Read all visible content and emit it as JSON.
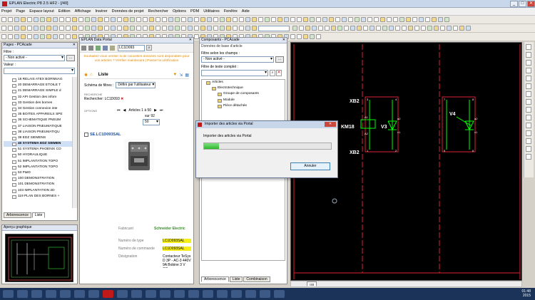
{
  "app": {
    "title": "EPLAN Electric P8 2.5 HF2 - [/40]",
    "min": "_",
    "max": "□",
    "close": "✕"
  },
  "menu": [
    "Projet",
    "Page",
    "Espace layout",
    "Edition",
    "Affichage",
    "Insérer",
    "Données de projet",
    "Rechercher",
    "Options",
    "PDM",
    "Utilitaires",
    "Fenêtre",
    "Aide"
  ],
  "toolbar": {
    "combo1": "",
    "combo2": "",
    "combo3": ""
  },
  "pages": {
    "title": "Pages - PCAcade",
    "filter_label": "Filtre :",
    "filter_value": "- Non activé -",
    "value_label": "Valeur :",
    "items": [
      {
        "label": "18 RELAIS ATEX BORNNAG",
        "bold": false,
        "sel": false
      },
      {
        "label": "20 DEMARRAGE ETOILE T",
        "bold": false,
        "sel": false
      },
      {
        "label": "21 DEMARRAGE SIMPLE d",
        "bold": false,
        "sel": false
      },
      {
        "label": "32 API Gestion des infom",
        "bold": false,
        "sel": false
      },
      {
        "label": "33 Gestion des bornes",
        "bold": false,
        "sel": false
      },
      {
        "label": "34 Gestion connexion inte",
        "bold": false,
        "sel": false
      },
      {
        "label": "35 BOITES APPAREILS SPE",
        "bold": false,
        "sel": false
      },
      {
        "label": "36 SCHEMATIQUE PNEUM",
        "bold": false,
        "sel": false
      },
      {
        "label": "37 LIAISON PNEUMATIQUE",
        "bold": false,
        "sel": false
      },
      {
        "label": "38 LIAISON PNEUMATIQU",
        "bold": false,
        "sel": false
      },
      {
        "label": "39 EDZ SIEMENS",
        "bold": false,
        "sel": false
      },
      {
        "label": "40 SYSTEMA EDZ SIEMEN",
        "bold": true,
        "sel": true
      },
      {
        "label": "51 SYSTEMA PHOENIX CO",
        "bold": false,
        "sel": false
      },
      {
        "label": "50 HYDRAULIQUE",
        "bold": false,
        "sel": false
      },
      {
        "label": "51 IMPLANTATION TOPO",
        "bold": false,
        "sel": false
      },
      {
        "label": "52 IMPLANTATION TOPO",
        "bold": false,
        "sel": false
      },
      {
        "label": "53 P&ID",
        "bold": false,
        "sel": false
      },
      {
        "label": "100 DEMONSTRATION",
        "bold": false,
        "sel": false
      },
      {
        "label": "101 DEMONSTRATION",
        "bold": false,
        "sel": false
      },
      {
        "label": "103 IMPLANTATION 2D",
        "bold": false,
        "sel": false
      },
      {
        "label": "119 PLAN DES BORNES +",
        "bold": false,
        "sel": false
      }
    ],
    "tabs": [
      "Arborescence",
      "Liste"
    ]
  },
  "preview": {
    "title": "Aperçu graphique"
  },
  "dataportal": {
    "title": "EPLAN Data Portal",
    "search_value": "LC1D093",
    "notice": "Souhaitez-vous vérifier si de nouvelles données sont disponibles pour vos articles ? Vérifier maintenant | Passer la vérification",
    "list_label": "Liste",
    "filter_label": "Schéma de filtres :",
    "filter_value": "Défini par l'utilisateur",
    "search_section": "RECHERCHE",
    "search_text": "Rechercher: LC1D093",
    "options_section": "OPTIONS",
    "pager": "Articles 1 à 50",
    "pager_total": "sur 92",
    "per_page": "50",
    "article_id": "SE.LC1D093SAL",
    "brand": "Schneider Electric",
    "rows": [
      {
        "k": "Fabricant",
        "v": "Schneider Electric",
        "hl": false
      },
      {
        "k": "Numéro de type",
        "v": "LC1D093SAL",
        "hl": true
      },
      {
        "k": "Numéro de commande",
        "v": "LC1D093SAL",
        "hl": true
      },
      {
        "k": "Désignation",
        "v": "Contacteur TeSys D 3P - AC-3 440V 9A Bobine 3 V CC",
        "hl": false
      }
    ]
  },
  "components": {
    "title": "Composants - PCAcade",
    "subtitle": "Données de base d'article",
    "filter_label": "Filtre selon les champs :",
    "filter_value": "- Non activé -",
    "fulltext_label": "Filtre de texte complet :",
    "tree": [
      {
        "label": "Articles",
        "lvl": 0
      },
      {
        "label": "Electrotechnique",
        "lvl": 1
      },
      {
        "label": "Groupe de composants",
        "lvl": 2
      },
      {
        "label": "Module",
        "lvl": 2
      },
      {
        "label": "Pièce détachée",
        "lvl": 2
      }
    ],
    "tabs": [
      "Arborescence",
      "Liste",
      "Combinaison"
    ]
  },
  "schematic": {
    "labels": [
      "XB2",
      "KM18",
      "V3",
      "XB2",
      "V4"
    ],
    "pins": [
      "3",
      "4",
      "A1",
      "A2",
      "1",
      "2",
      "a2",
      "x1",
      "7",
      "8",
      "a2",
      "x1",
      "5",
      "6"
    ],
    "page_tab": "/40"
  },
  "dialog": {
    "title": "Importer des articles via Portal",
    "message": "Importer des articles via Portal",
    "progress": 0.12,
    "cancel": "Annuler"
  },
  "taskbar": {
    "time": "01:48",
    "date": "2015"
  }
}
